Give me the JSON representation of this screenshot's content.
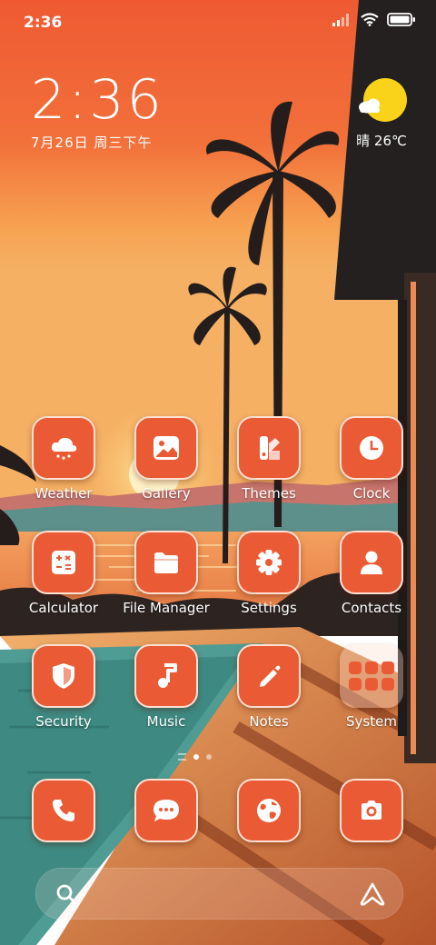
{
  "status_bar": {
    "time": "2:36"
  },
  "clock_widget": {
    "time": "2:36",
    "date": "7月26日 周三下午"
  },
  "weather_widget": {
    "text": "晴 26℃",
    "icon": "partly-sunny-icon"
  },
  "apps": [
    {
      "label": "Weather",
      "icon": "weather-icon"
    },
    {
      "label": "Gallery",
      "icon": "gallery-icon"
    },
    {
      "label": "Themes",
      "icon": "themes-icon"
    },
    {
      "label": "Clock",
      "icon": "clock-icon"
    },
    {
      "label": "Calculator",
      "icon": "calculator-icon"
    },
    {
      "label": "File Manager",
      "icon": "folder-icon"
    },
    {
      "label": "Settings",
      "icon": "gear-icon"
    },
    {
      "label": "Contacts",
      "icon": "contact-icon"
    },
    {
      "label": "Security",
      "icon": "shield-icon"
    },
    {
      "label": "Music",
      "icon": "music-note-icon"
    },
    {
      "label": "Notes",
      "icon": "pencil-icon"
    },
    {
      "label": "System",
      "icon": "folder-grid-icon"
    }
  ],
  "dock": [
    {
      "icon": "phone-icon"
    },
    {
      "icon": "message-icon"
    },
    {
      "icon": "browser-globe-icon"
    },
    {
      "icon": "camera-icon"
    }
  ],
  "page_indicator": {
    "pages": 2,
    "active": 1
  },
  "search_bar": {
    "left_icon": "search-icon",
    "right_icon": "assistant-icon"
  },
  "colors": {
    "icon_bg": "#ea5a35",
    "sky_top": "#ef5a33",
    "sun": "#f9d21a",
    "water": "#4f9c94"
  }
}
